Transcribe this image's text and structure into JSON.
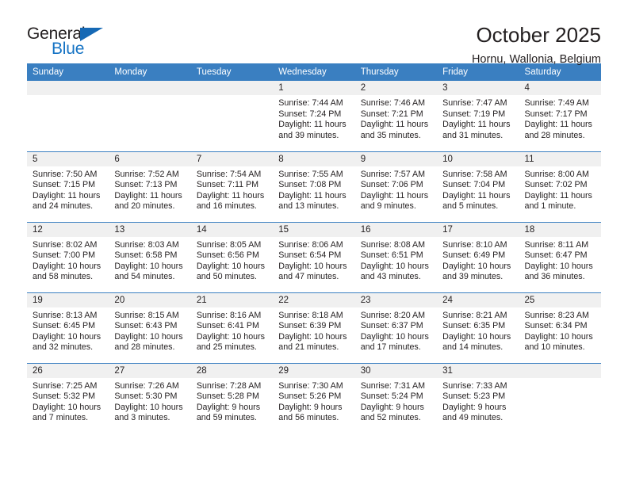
{
  "logo": {
    "line1": "General",
    "line2": "Blue",
    "triangle_color": "#1669b5",
    "blue_color": "#1573c4"
  },
  "header": {
    "title": "October 2025",
    "subtitle": "Hornu, Wallonia, Belgium",
    "header_bg": "#3a7fc1",
    "daynum_bg": "#f0f0f0"
  },
  "weekday_headers": [
    "Sunday",
    "Monday",
    "Tuesday",
    "Wednesday",
    "Thursday",
    "Friday",
    "Saturday"
  ],
  "labels": {
    "sunrise": "Sunrise:",
    "sunset": "Sunset:",
    "daylight": "Daylight:"
  },
  "weeks": [
    [
      {
        "day": ""
      },
      {
        "day": ""
      },
      {
        "day": ""
      },
      {
        "day": "1",
        "sunrise": "Sunrise: 7:44 AM",
        "sunset": "Sunset: 7:24 PM",
        "daylight": "Daylight: 11 hours and 39 minutes."
      },
      {
        "day": "2",
        "sunrise": "Sunrise: 7:46 AM",
        "sunset": "Sunset: 7:21 PM",
        "daylight": "Daylight: 11 hours and 35 minutes."
      },
      {
        "day": "3",
        "sunrise": "Sunrise: 7:47 AM",
        "sunset": "Sunset: 7:19 PM",
        "daylight": "Daylight: 11 hours and 31 minutes."
      },
      {
        "day": "4",
        "sunrise": "Sunrise: 7:49 AM",
        "sunset": "Sunset: 7:17 PM",
        "daylight": "Daylight: 11 hours and 28 minutes."
      }
    ],
    [
      {
        "day": "5",
        "sunrise": "Sunrise: 7:50 AM",
        "sunset": "Sunset: 7:15 PM",
        "daylight": "Daylight: 11 hours and 24 minutes."
      },
      {
        "day": "6",
        "sunrise": "Sunrise: 7:52 AM",
        "sunset": "Sunset: 7:13 PM",
        "daylight": "Daylight: 11 hours and 20 minutes."
      },
      {
        "day": "7",
        "sunrise": "Sunrise: 7:54 AM",
        "sunset": "Sunset: 7:11 PM",
        "daylight": "Daylight: 11 hours and 16 minutes."
      },
      {
        "day": "8",
        "sunrise": "Sunrise: 7:55 AM",
        "sunset": "Sunset: 7:08 PM",
        "daylight": "Daylight: 11 hours and 13 minutes."
      },
      {
        "day": "9",
        "sunrise": "Sunrise: 7:57 AM",
        "sunset": "Sunset: 7:06 PM",
        "daylight": "Daylight: 11 hours and 9 minutes."
      },
      {
        "day": "10",
        "sunrise": "Sunrise: 7:58 AM",
        "sunset": "Sunset: 7:04 PM",
        "daylight": "Daylight: 11 hours and 5 minutes."
      },
      {
        "day": "11",
        "sunrise": "Sunrise: 8:00 AM",
        "sunset": "Sunset: 7:02 PM",
        "daylight": "Daylight: 11 hours and 1 minute."
      }
    ],
    [
      {
        "day": "12",
        "sunrise": "Sunrise: 8:02 AM",
        "sunset": "Sunset: 7:00 PM",
        "daylight": "Daylight: 10 hours and 58 minutes."
      },
      {
        "day": "13",
        "sunrise": "Sunrise: 8:03 AM",
        "sunset": "Sunset: 6:58 PM",
        "daylight": "Daylight: 10 hours and 54 minutes."
      },
      {
        "day": "14",
        "sunrise": "Sunrise: 8:05 AM",
        "sunset": "Sunset: 6:56 PM",
        "daylight": "Daylight: 10 hours and 50 minutes."
      },
      {
        "day": "15",
        "sunrise": "Sunrise: 8:06 AM",
        "sunset": "Sunset: 6:54 PM",
        "daylight": "Daylight: 10 hours and 47 minutes."
      },
      {
        "day": "16",
        "sunrise": "Sunrise: 8:08 AM",
        "sunset": "Sunset: 6:51 PM",
        "daylight": "Daylight: 10 hours and 43 minutes."
      },
      {
        "day": "17",
        "sunrise": "Sunrise: 8:10 AM",
        "sunset": "Sunset: 6:49 PM",
        "daylight": "Daylight: 10 hours and 39 minutes."
      },
      {
        "day": "18",
        "sunrise": "Sunrise: 8:11 AM",
        "sunset": "Sunset: 6:47 PM",
        "daylight": "Daylight: 10 hours and 36 minutes."
      }
    ],
    [
      {
        "day": "19",
        "sunrise": "Sunrise: 8:13 AM",
        "sunset": "Sunset: 6:45 PM",
        "daylight": "Daylight: 10 hours and 32 minutes."
      },
      {
        "day": "20",
        "sunrise": "Sunrise: 8:15 AM",
        "sunset": "Sunset: 6:43 PM",
        "daylight": "Daylight: 10 hours and 28 minutes."
      },
      {
        "day": "21",
        "sunrise": "Sunrise: 8:16 AM",
        "sunset": "Sunset: 6:41 PM",
        "daylight": "Daylight: 10 hours and 25 minutes."
      },
      {
        "day": "22",
        "sunrise": "Sunrise: 8:18 AM",
        "sunset": "Sunset: 6:39 PM",
        "daylight": "Daylight: 10 hours and 21 minutes."
      },
      {
        "day": "23",
        "sunrise": "Sunrise: 8:20 AM",
        "sunset": "Sunset: 6:37 PM",
        "daylight": "Daylight: 10 hours and 17 minutes."
      },
      {
        "day": "24",
        "sunrise": "Sunrise: 8:21 AM",
        "sunset": "Sunset: 6:35 PM",
        "daylight": "Daylight: 10 hours and 14 minutes."
      },
      {
        "day": "25",
        "sunrise": "Sunrise: 8:23 AM",
        "sunset": "Sunset: 6:34 PM",
        "daylight": "Daylight: 10 hours and 10 minutes."
      }
    ],
    [
      {
        "day": "26",
        "sunrise": "Sunrise: 7:25 AM",
        "sunset": "Sunset: 5:32 PM",
        "daylight": "Daylight: 10 hours and 7 minutes."
      },
      {
        "day": "27",
        "sunrise": "Sunrise: 7:26 AM",
        "sunset": "Sunset: 5:30 PM",
        "daylight": "Daylight: 10 hours and 3 minutes."
      },
      {
        "day": "28",
        "sunrise": "Sunrise: 7:28 AM",
        "sunset": "Sunset: 5:28 PM",
        "daylight": "Daylight: 9 hours and 59 minutes."
      },
      {
        "day": "29",
        "sunrise": "Sunrise: 7:30 AM",
        "sunset": "Sunset: 5:26 PM",
        "daylight": "Daylight: 9 hours and 56 minutes."
      },
      {
        "day": "30",
        "sunrise": "Sunrise: 7:31 AM",
        "sunset": "Sunset: 5:24 PM",
        "daylight": "Daylight: 9 hours and 52 minutes."
      },
      {
        "day": "31",
        "sunrise": "Sunrise: 7:33 AM",
        "sunset": "Sunset: 5:23 PM",
        "daylight": "Daylight: 9 hours and 49 minutes."
      },
      {
        "day": ""
      }
    ]
  ]
}
